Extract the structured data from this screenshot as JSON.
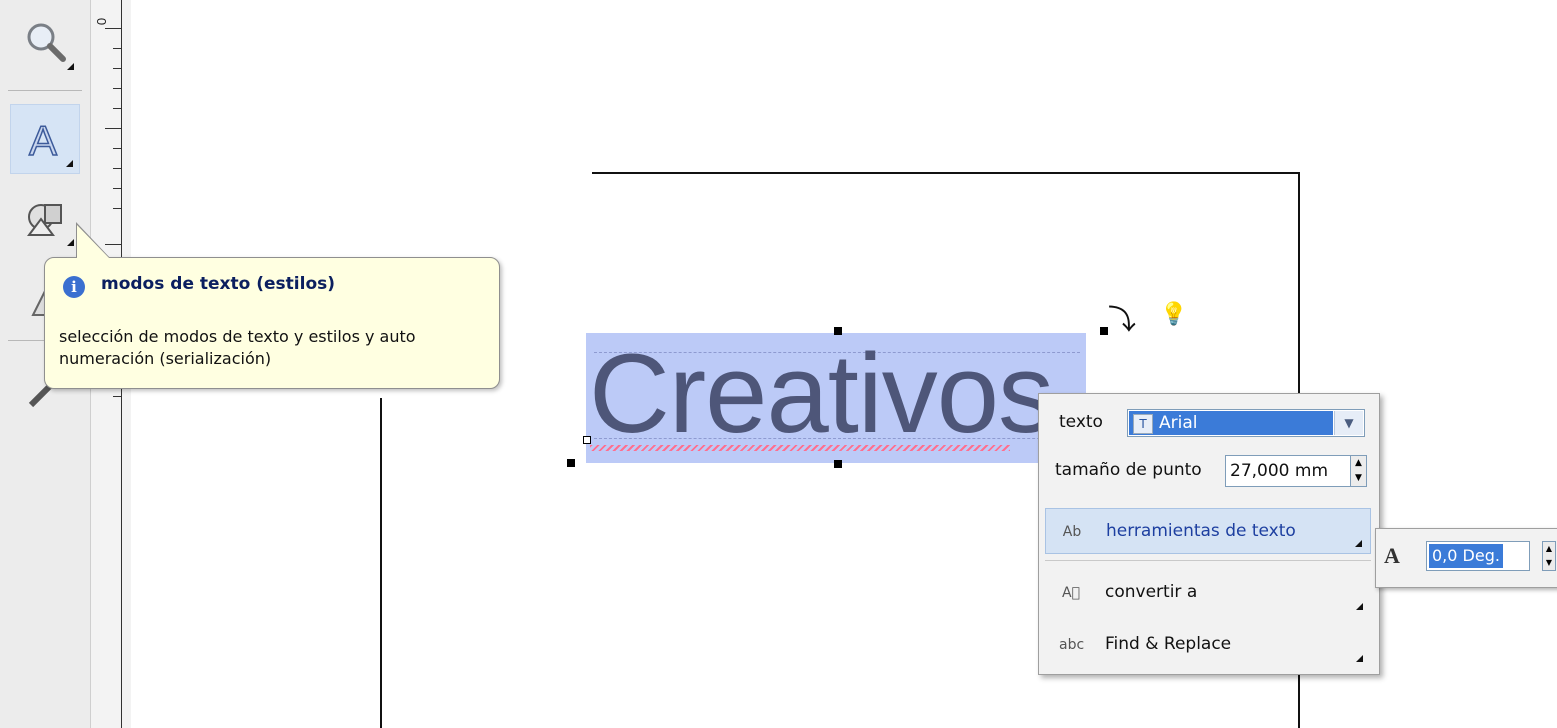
{
  "toolbar": {
    "tools": [
      {
        "name": "zoom-tool",
        "icon": "magnifier-icon"
      },
      {
        "name": "text-tool",
        "icon": "text-a-icon",
        "active": true
      },
      {
        "name": "shapes-tool",
        "icon": "shapes-icon"
      },
      {
        "name": "warning-tool",
        "icon": "warning-icon"
      },
      {
        "name": "pen-tool",
        "icon": "pen-icon"
      }
    ]
  },
  "ruler": {
    "zero_label": "0"
  },
  "canvas": {
    "text": "Creativos"
  },
  "tooltip": {
    "title": "modos de texto (estilos)",
    "body": "selección de modos de texto y estilos y auto numeración (serialización)"
  },
  "panel": {
    "font_label": "texto",
    "font_value": "Arial",
    "size_label": "tamaño de punto",
    "size_value": "27,000 mm",
    "menu": [
      {
        "label": "herramientas de texto",
        "icon": "text-tools-icon",
        "highlighted": true
      },
      {
        "label": "convertir a",
        "icon": "convert-icon"
      },
      {
        "label": "Find & Replace",
        "icon": "find-replace-icon"
      }
    ]
  },
  "subpanel": {
    "angle_value": "0,0 Deg."
  },
  "colors": {
    "selection": "#bccaf7",
    "text": "#4e5679",
    "tooltip_bg": "#ffffe1",
    "accent": "#3b7bd8"
  }
}
